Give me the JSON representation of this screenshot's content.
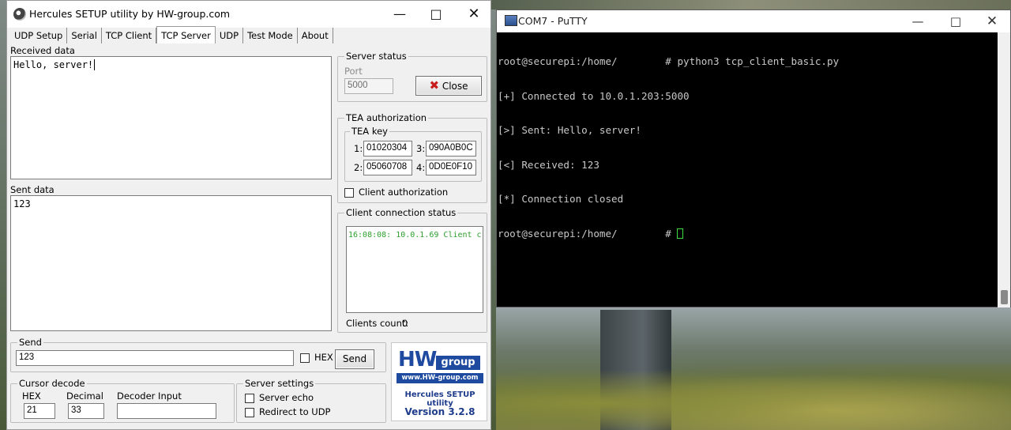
{
  "hercules": {
    "title": "Hercules SETUP utility by HW-group.com",
    "tabs": [
      "UDP Setup",
      "Serial",
      "TCP Client",
      "TCP Server",
      "UDP",
      "Test Mode",
      "About"
    ],
    "active_tab": "TCP Server",
    "received_label": "Received data",
    "received_text": "Hello, server!",
    "sent_label": "Sent data",
    "sent_text": "123",
    "server_status": {
      "title": "Server status",
      "port_label": "Port",
      "port_value": "5000",
      "close_label": "Close"
    },
    "tea": {
      "title": "TEA authorization",
      "key_title": "TEA key",
      "keys": [
        {
          "n": "1:",
          "v": "01020304"
        },
        {
          "n": "3:",
          "v": "090A0B0C"
        },
        {
          "n": "2:",
          "v": "05060708"
        },
        {
          "n": "4:",
          "v": "0D0E0F10"
        }
      ],
      "client_auth_label": "Client authorization"
    },
    "client_status": {
      "title": "Client connection status",
      "log": "16:08:08:  10.0.1.69 Client c",
      "count_label": "Clients count:",
      "count_value": "0"
    },
    "send": {
      "title": "Send",
      "value": "123",
      "hex_label": "HEX",
      "send_label": "Send"
    },
    "cursor_decode": {
      "title": "Cursor decode",
      "hex_label": "HEX",
      "decimal_label": "Decimal",
      "decoder_label": "Decoder Input",
      "hex_value": "21",
      "decimal_value": "33",
      "decoder_value": ""
    },
    "server_settings": {
      "title": "Server settings",
      "echo_label": "Server echo",
      "redirect_label": "Redirect to UDP"
    },
    "logo": {
      "hw": "HW",
      "group": "group",
      "www": "www.HW-group.com",
      "product": "Hercules SETUP utility",
      "version": "Version  3.2.8"
    }
  },
  "putty": {
    "title": "COM7 - PuTTY",
    "lines": [
      "root@securepi:/home/        # python3 tcp_client_basic.py",
      "[+] Connected to 10.0.1.203:5000",
      "[>] Sent: Hello, server!",
      "[<] Received: 123",
      "[*] Connection closed",
      "root@securepi:/home/        # "
    ]
  },
  "colors": {
    "log_green": "#2ea02e",
    "hw_blue": "#1e4aa0",
    "terminal_bg": "#000000",
    "terminal_fg": "#c8c8c8",
    "cursor_green": "#3cdc3c"
  }
}
